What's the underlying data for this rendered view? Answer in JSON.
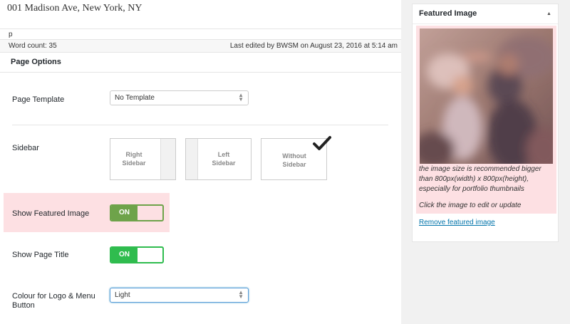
{
  "editor": {
    "content_line": "001 Madison Ave, New York, NY",
    "path": "p",
    "word_count": "Word count: 35",
    "last_edited": "Last edited by BWSM on August 23, 2016 at 5:14 am"
  },
  "page_options": {
    "title": "Page Options",
    "page_template": {
      "label": "Page Template",
      "value": "No Template"
    },
    "sidebar": {
      "label": "Sidebar",
      "options": [
        {
          "line1": "Right",
          "line2": "Sidebar"
        },
        {
          "line1": "Left",
          "line2": "Sidebar"
        },
        {
          "line1": "Without",
          "line2": "Sidebar"
        }
      ],
      "selected_index": 2
    },
    "show_featured_image": {
      "label": "Show Featured Image",
      "state": "ON"
    },
    "show_page_title": {
      "label": "Show Page Title",
      "state": "ON"
    },
    "colour_logo": {
      "label_line1": "Colour for Logo & Menu",
      "label_line2": "Button",
      "value": "Light"
    }
  },
  "featured_image": {
    "title": "Featured Image",
    "note_lines": [
      "the image size is recommended bigger",
      "than 800px(width) x 800px(height),",
      "especially for portfolio thumbnails"
    ],
    "click_note": "Click the image to edit or update",
    "remove_link": "Remove featured image"
  },
  "colors": {
    "highlight_pink": "#fde0e3",
    "toggle_green_dim": "#6ea34a",
    "toggle_green": "#2fbc4e",
    "link_blue": "#0073aa"
  }
}
